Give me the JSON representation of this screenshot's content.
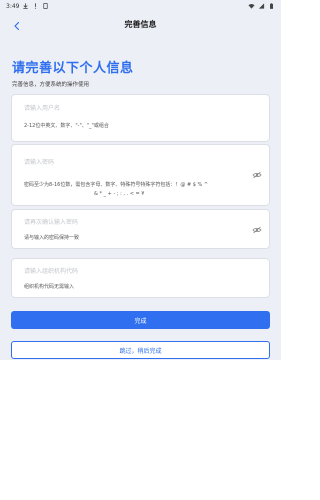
{
  "status_bar": {
    "time": "3:49",
    "icons_left": [
      "download-icon",
      "alert-icon",
      "sim-icon"
    ],
    "icons_right": [
      "wifi-icon",
      "signal-icon",
      "battery-icon"
    ]
  },
  "header": {
    "title": "完善信息",
    "back_icon": "chevron-left-icon"
  },
  "intro": {
    "title": "请完善以下个人信息",
    "subtitle": "完善信息，方便系统的操作使用"
  },
  "form": {
    "username": {
      "placeholder": "请输入用户名",
      "hint": "2-12位中英文、数字、\"-\"、\"_\"或组合"
    },
    "password": {
      "placeholder": "请输入密码",
      "hint_line1": "密码至少为8-16位数，需包含字母、数字、特殊符号特殊字符包括：！@ # $ % ^",
      "hint_line2": "& * _ + - ; : , . < = ¥",
      "eye_icon": "eye-hidden-icon"
    },
    "password_confirm": {
      "placeholder": "请再次确认输入密码",
      "hint": "请与输入的密码保持一致",
      "eye_icon": "eye-hidden-icon"
    },
    "org_code": {
      "placeholder": "请输入组织机构代码",
      "hint": "组织机构代码无需输入"
    }
  },
  "actions": {
    "submit_label": "完成",
    "skip_label": "跳过，稍后完成"
  },
  "colors": {
    "accent": "#2f6ff0",
    "background": "#eceff5"
  }
}
